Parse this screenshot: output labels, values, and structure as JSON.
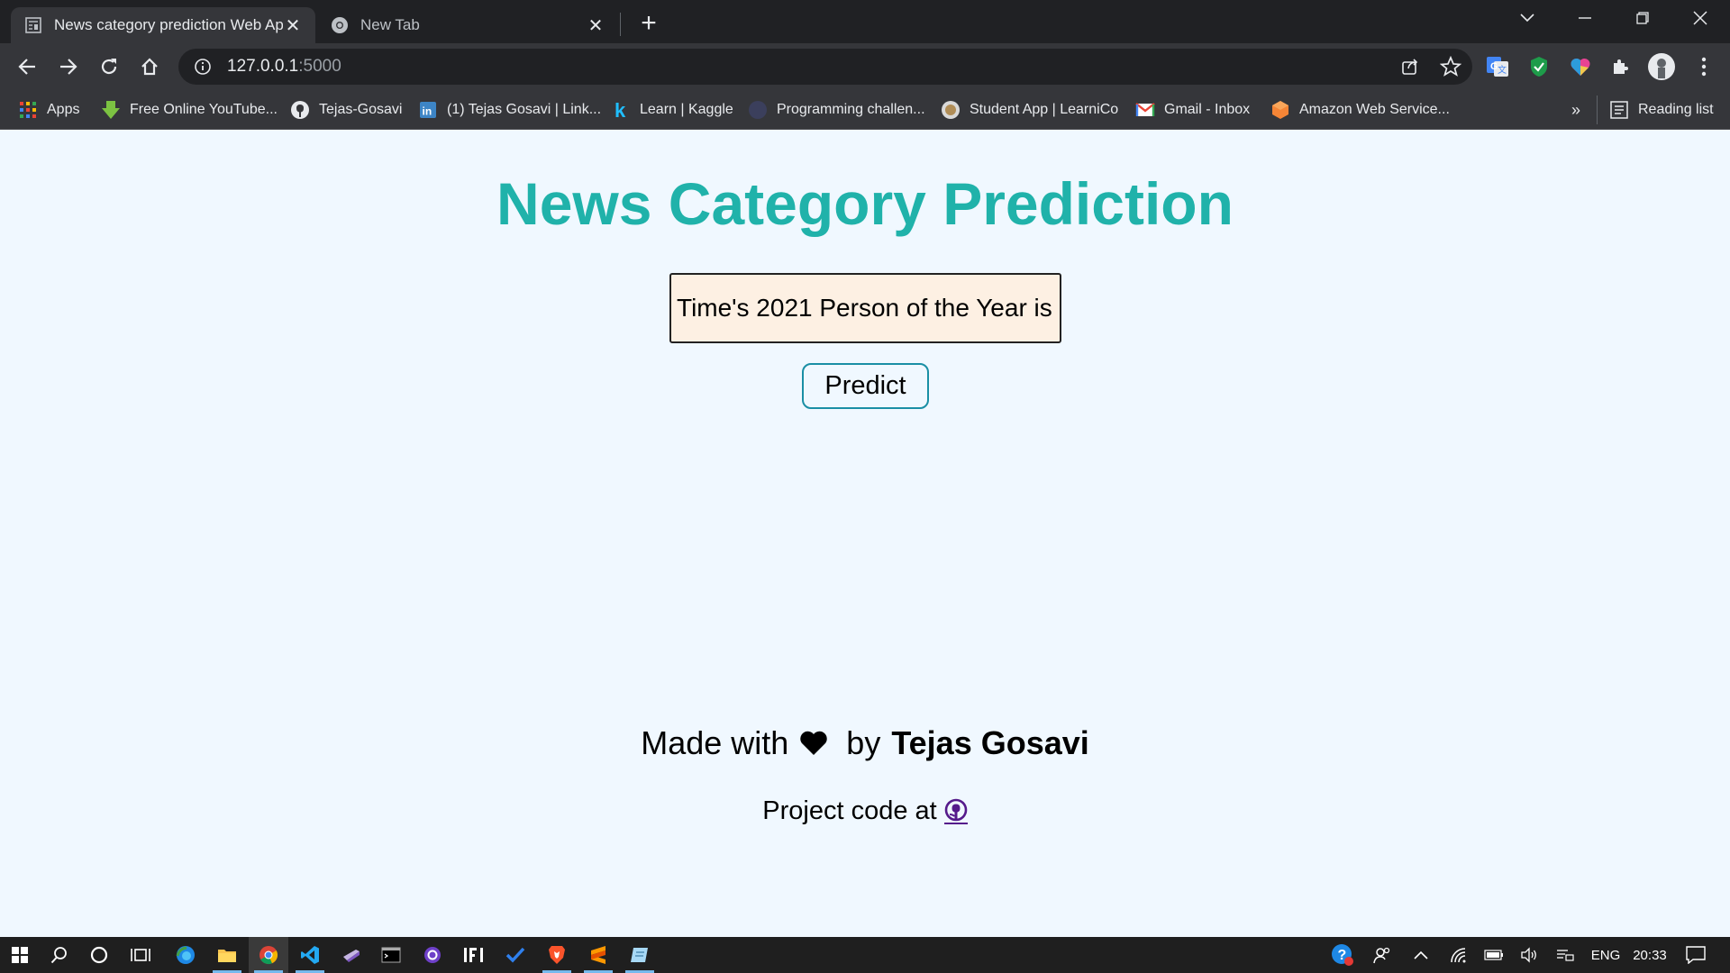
{
  "browser": {
    "tabs": [
      {
        "title": "News category prediction Web App",
        "active": true,
        "icon": "page-icon"
      },
      {
        "title": "New Tab",
        "active": false,
        "icon": "chrome-icon"
      }
    ],
    "address": {
      "host": "127.0.0.1",
      "port": ":5000"
    },
    "bookmarks": [
      {
        "label": "Apps",
        "icon": "apps-grid-icon"
      },
      {
        "label": "Free Online YouTube...",
        "icon": "download-arrow-icon"
      },
      {
        "label": "Tejas-Gosavi",
        "icon": "github-icon"
      },
      {
        "label": "(1) Tejas Gosavi | Link...",
        "icon": "linkedin-icon"
      },
      {
        "label": "Learn | Kaggle",
        "icon": "kaggle-icon"
      },
      {
        "label": "Programming challen...",
        "icon": "site-icon"
      },
      {
        "label": "Student App | LearniCo",
        "icon": "learnico-icon"
      },
      {
        "label": "Gmail - Inbox",
        "icon": "gmail-icon"
      },
      {
        "label": "Amazon Web Service...",
        "icon": "aws-icon"
      }
    ],
    "overflow_label": "»",
    "reading_list": "Reading list"
  },
  "page": {
    "title": "News Category Prediction",
    "input_value": "Time's 2021 Person of the Year is",
    "predict_label": "Predict",
    "made_with": "Made with",
    "by": "by",
    "author": "Tejas Gosavi",
    "project_code": "Project code at"
  },
  "taskbar": {
    "lang": "ENG",
    "time": "20:33"
  },
  "colors": {
    "title": "#20b2aa",
    "page_bg": "#f0f8ff",
    "input_bg": "#fdf0e3",
    "button_border": "#1a8fa5"
  }
}
